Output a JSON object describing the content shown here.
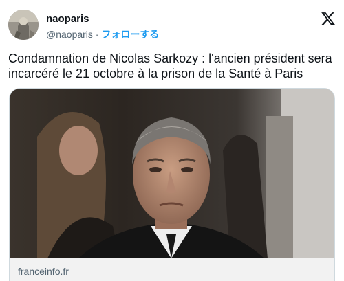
{
  "account": {
    "name": "naoparis",
    "handle": "@naoparis",
    "separator": " · ",
    "follow_label": "フォローする"
  },
  "icons": {
    "platform_logo": "x-logo-icon",
    "avatar": "user-avatar"
  },
  "tweet": {
    "text": "Condamnation de Nicolas Sarkozy : l'ancien président sera incarcéré le 21 octobre à la prison de la Santé à Paris"
  },
  "link_card": {
    "source": "franceinfo.fr"
  },
  "colors": {
    "accent": "#1d9bf0",
    "text_primary": "#0f1419",
    "text_secondary": "#536471",
    "border": "#cfd9de"
  }
}
